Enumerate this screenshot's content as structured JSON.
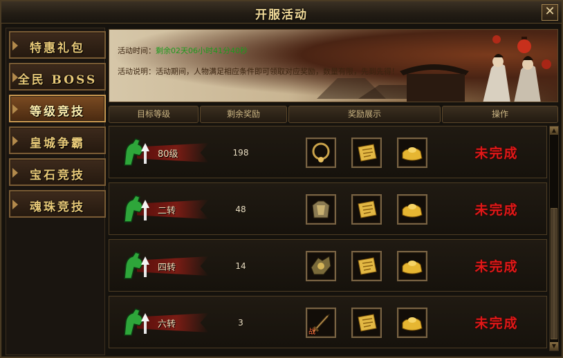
{
  "window": {
    "title": "开服活动",
    "close_glyph": "✕"
  },
  "sidebar": {
    "items": [
      {
        "label": "特惠礼包",
        "active": false
      },
      {
        "label": "全民 BOSS",
        "active": false
      },
      {
        "label": "等级竞技",
        "active": true
      },
      {
        "label": "皇城争霸",
        "active": false
      },
      {
        "label": "宝石竞技",
        "active": false
      },
      {
        "label": "魂珠竞技",
        "active": false
      }
    ]
  },
  "banner": {
    "time_label": "活动时间：",
    "time_value": "剩余02天06小时41分40秒",
    "desc_label": "活动说明：",
    "desc_value": "活动期间，人物满足相应条件即可领取对应奖励，数量有限，先到先得！"
  },
  "table": {
    "headers": [
      "目标等级",
      "剩余奖励",
      "奖励展示",
      "操作"
    ],
    "rows": [
      {
        "level": "80级",
        "remaining": "198",
        "rewards": [
          "necklace-icon",
          "scroll-icon",
          "gold-ingot-icon"
        ],
        "reward_tag": "",
        "status": "未完成"
      },
      {
        "level": "二转",
        "remaining": "48",
        "rewards": [
          "armor-icon",
          "scroll-icon",
          "gold-ingot-icon"
        ],
        "reward_tag": "",
        "status": "未完成"
      },
      {
        "level": "四转",
        "remaining": "14",
        "rewards": [
          "gear-set-icon",
          "scroll-icon",
          "gold-ingot-icon"
        ],
        "reward_tag": "",
        "status": "未完成"
      },
      {
        "level": "六转",
        "remaining": "3",
        "rewards": [
          "sword-icon",
          "scroll-icon",
          "gold-ingot-icon"
        ],
        "reward_tag": "战",
        "status": "未完成"
      }
    ]
  },
  "colors": {
    "status_incomplete": "#e01818",
    "time_value": "#1e9a1e",
    "accent_gold": "#e8c978"
  }
}
